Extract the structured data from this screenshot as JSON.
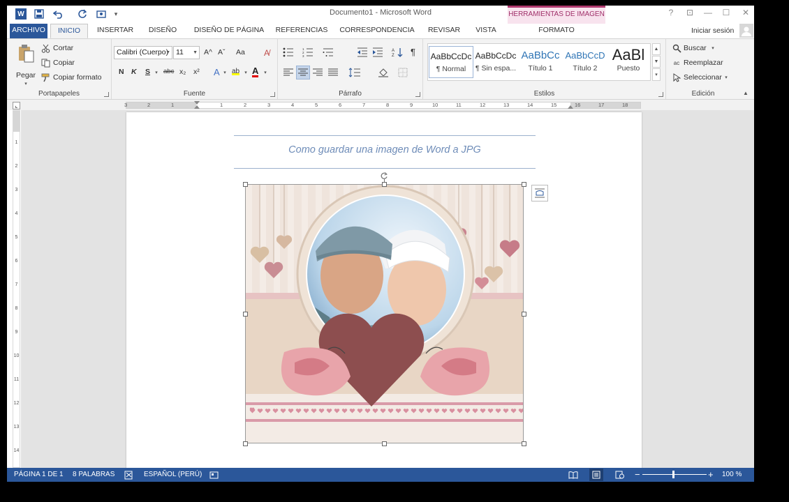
{
  "window": {
    "title": "Documento1 - Microsoft Word",
    "context_header": "HERRAMIENTAS DE IMAGEN",
    "help": "?",
    "restore_ribbon": "⊡",
    "minimize": "—",
    "maximize": "☐",
    "close": "✕"
  },
  "qat": {
    "customize_glyph": "▾"
  },
  "tabs": [
    {
      "label": "ARCHIVO"
    },
    {
      "label": "INICIO"
    },
    {
      "label": "INSERTAR"
    },
    {
      "label": "DISEÑO"
    },
    {
      "label": "DISEÑO DE PÁGINA"
    },
    {
      "label": "REFERENCIAS"
    },
    {
      "label": "CORRESPONDENCIA"
    },
    {
      "label": "REVISAR"
    },
    {
      "label": "VISTA"
    },
    {
      "label": "FORMATO"
    }
  ],
  "user": {
    "signin": "Iniciar sesión"
  },
  "ribbon": {
    "clipboard": {
      "label": "Portapapeles",
      "paste": "Pegar",
      "cut": "Cortar",
      "copy": "Copiar",
      "format_painter": "Copiar formato"
    },
    "font": {
      "label": "Fuente",
      "font_name": "Calibri (Cuerpo)",
      "font_size": "11",
      "bold": "N",
      "italic": "K",
      "underline": "S",
      "strike": "abc",
      "sub": "x₂",
      "sup": "x²",
      "grow": "A^",
      "shrink": "Aˇ",
      "case": "Aa",
      "text_effects": "A",
      "highlight": "ab",
      "font_color": "A"
    },
    "paragraph": {
      "label": "Párrafo",
      "pilcrow": "¶"
    },
    "styles": {
      "label": "Estilos",
      "items": [
        {
          "preview": "AaBbCcDc",
          "name": "¶ Normal"
        },
        {
          "preview": "AaBbCcDc",
          "name": "¶ Sin espa..."
        },
        {
          "preview": "AaBbCc",
          "name": "Título 1"
        },
        {
          "preview": "AaBbCcD",
          "name": "Título 2"
        },
        {
          "preview": "AaBl",
          "name": "Puesto"
        }
      ]
    },
    "editing": {
      "label": "Edición",
      "find": "Buscar",
      "replace": "Reemplazar",
      "select": "Seleccionar"
    }
  },
  "ruler": {
    "ticks": [
      "3",
      "2",
      "1",
      "1",
      "2",
      "3",
      "4",
      "5",
      "6",
      "7",
      "8",
      "9",
      "10",
      "11",
      "12",
      "13",
      "14",
      "15",
      "16",
      "17",
      "18"
    ],
    "vticks": [
      "1",
      "2",
      "3",
      "4",
      "5",
      "6",
      "7",
      "8",
      "9",
      "10",
      "11",
      "12",
      "13",
      "14"
    ]
  },
  "document": {
    "heading": "Como guardar una imagen de Word a JPG"
  },
  "status": {
    "page": "PÁGINA 1 DE 1",
    "words": "8 PALABRAS",
    "language": "ESPAÑOL (PERÚ)",
    "zoom": "100 %",
    "minus": "−",
    "plus": "+"
  }
}
